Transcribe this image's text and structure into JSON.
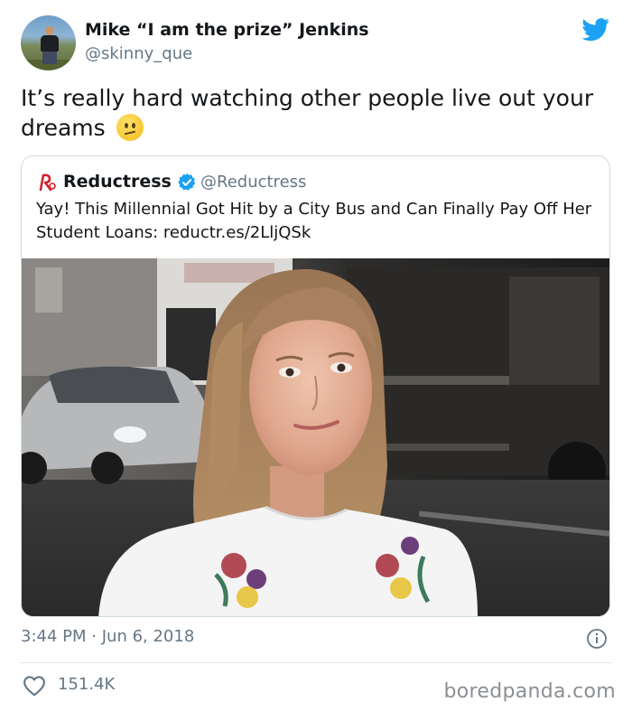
{
  "author": {
    "name": "Mike “I am the prize” Jenkins",
    "handle": "@skinny_que",
    "avatar_icon": "profile-photo"
  },
  "tweet": {
    "text": "It’s really hard watching other people live out your dreams",
    "emoji": "confused-face-emoji"
  },
  "quoted": {
    "name": "Reductress",
    "handle": "@Reductress",
    "verified": true,
    "logo_icon": "reductress-logo",
    "text": "Yay! This Millennial Got Hit by a City Bus and Can Finally Pay Off Her Student Loans: reductr.es/2LljQSk",
    "image_icon": "news-photo"
  },
  "meta": {
    "time": "3:44 PM",
    "separator": "·",
    "date": "Jun 6, 2018",
    "likes": "151.4K"
  },
  "watermark": "boredpanda.com",
  "colors": {
    "twitter_blue": "#1da1f2",
    "verified_blue": "#1da1f2",
    "reductress_red": "#d2232a",
    "secondary_text": "#657786",
    "text": "#14171a",
    "border": "#cfd9de"
  }
}
